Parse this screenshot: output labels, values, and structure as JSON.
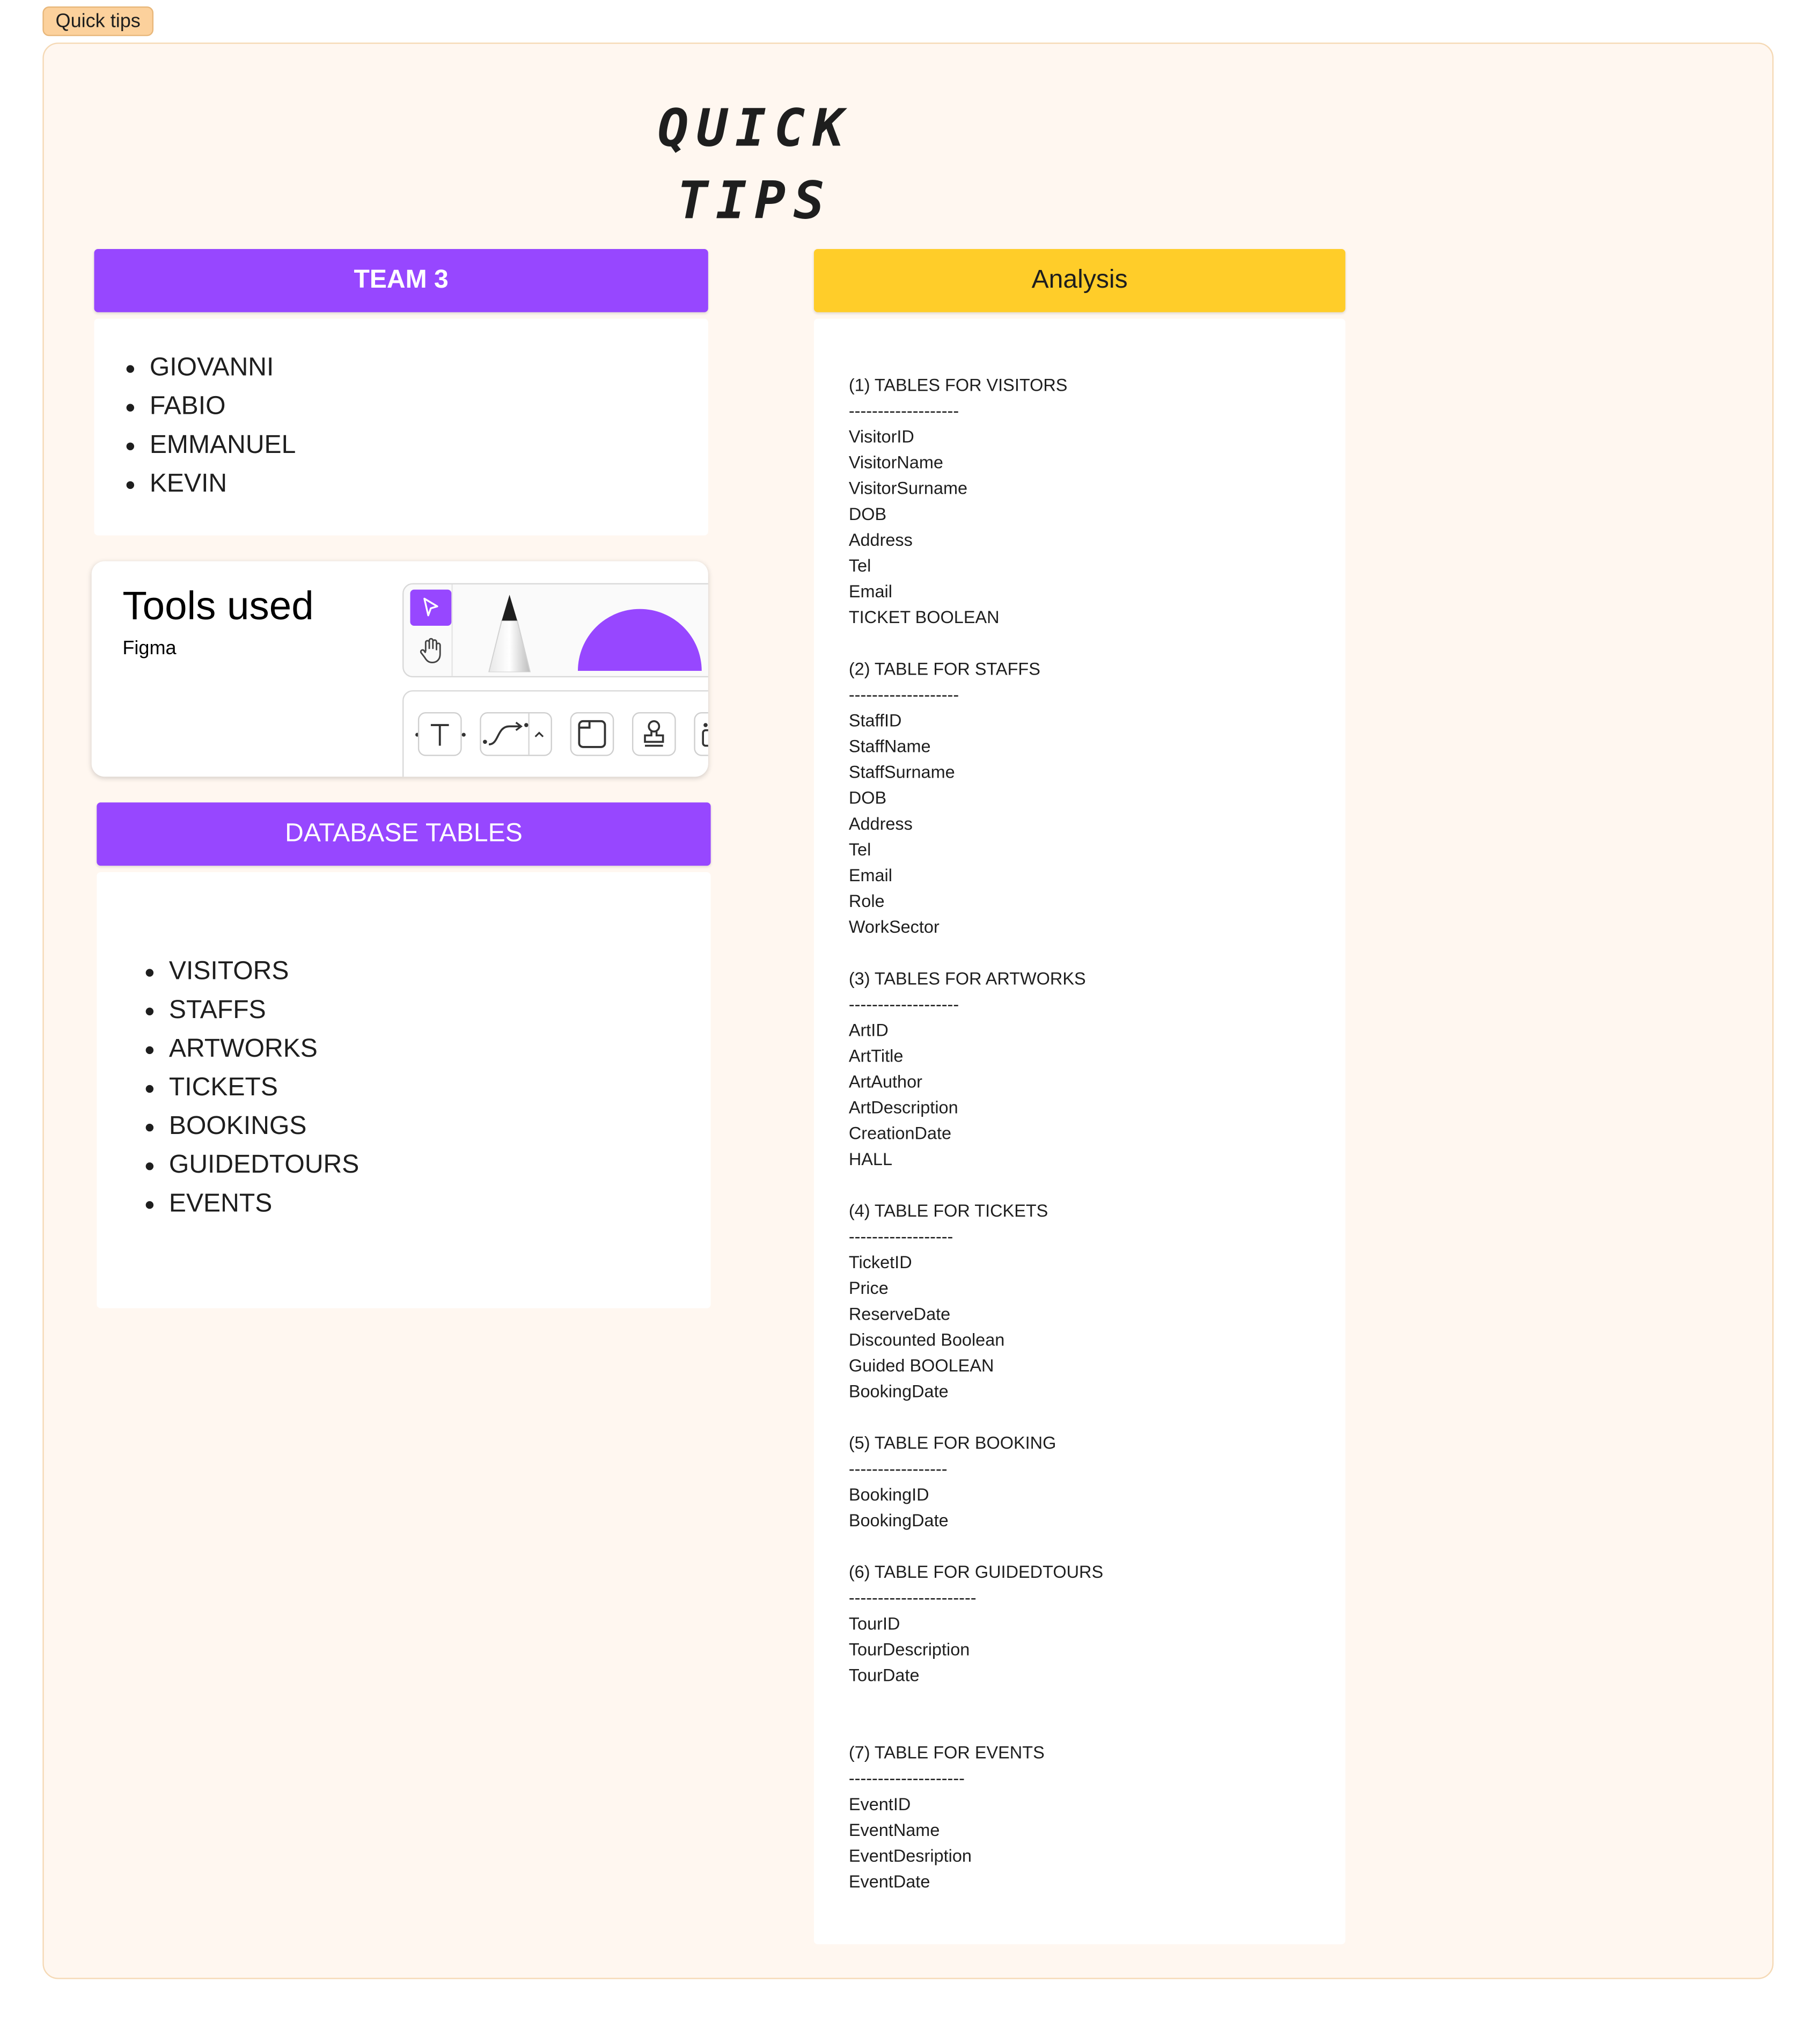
{
  "section_label": "Quick tips",
  "title": "QUICK TIPS",
  "team": {
    "header": "TEAM 3",
    "members": [
      "GIOVANNI",
      "FABIO",
      "EMMANUEL",
      "KEVIN"
    ]
  },
  "tools": {
    "title": "Tools used",
    "subtitle": "Figma",
    "icons": [
      "cursor-icon",
      "hand-icon",
      "pen-icon",
      "semicircle-shape-icon",
      "text-tool-icon",
      "connector-tool-icon",
      "chevron-up-icon",
      "section-tool-icon",
      "stamp-tool-icon"
    ]
  },
  "database": {
    "header": "DATABASE TABLES",
    "tables": [
      "VISITORS",
      "STAFFS",
      "ARTWORKS",
      "TICKETS",
      "BOOKINGS",
      "GUIDEDTOURS",
      "EVENTS"
    ]
  },
  "analysis": {
    "header": "Analysis",
    "text": "(1) TABLES FOR VISITORS\n-------------------\nVisitorID\nVisitorName\nVisitorSurname\nDOB\nAddress\nTel\nEmail\nTICKET BOOLEAN\n\n(2) TABLE FOR STAFFS\n-------------------\nStaffID\nStaffName\nStaffSurname\nDOB\nAddress\nTel\nEmail\nRole\nWorkSector\n\n(3) TABLES FOR ARTWORKS\n-------------------\nArtID\nArtTitle\nArtAuthor\nArtDescription\nCreationDate\nHALL\n\n(4) TABLE FOR TICKETS\n------------------\nTicketID\nPrice\nReserveDate\nDiscounted Boolean\nGuided BOOLEAN\nBookingDate\n\n(5) TABLE FOR BOOKING\n-----------------\nBookingID\nBookingDate\n\n(6) TABLE FOR GUIDEDTOURS\n----------------------\nTourID\nTourDescription\nTourDate\n\n\n(7) TABLE FOR EVENTS\n--------------------\nEventID\nEventName\nEventDesription\nEventDate"
  },
  "colors": {
    "purple": "#9747ff",
    "yellow": "#ffcd29",
    "section_bg": "#fff7f0",
    "label_bg": "#fcd19c"
  }
}
